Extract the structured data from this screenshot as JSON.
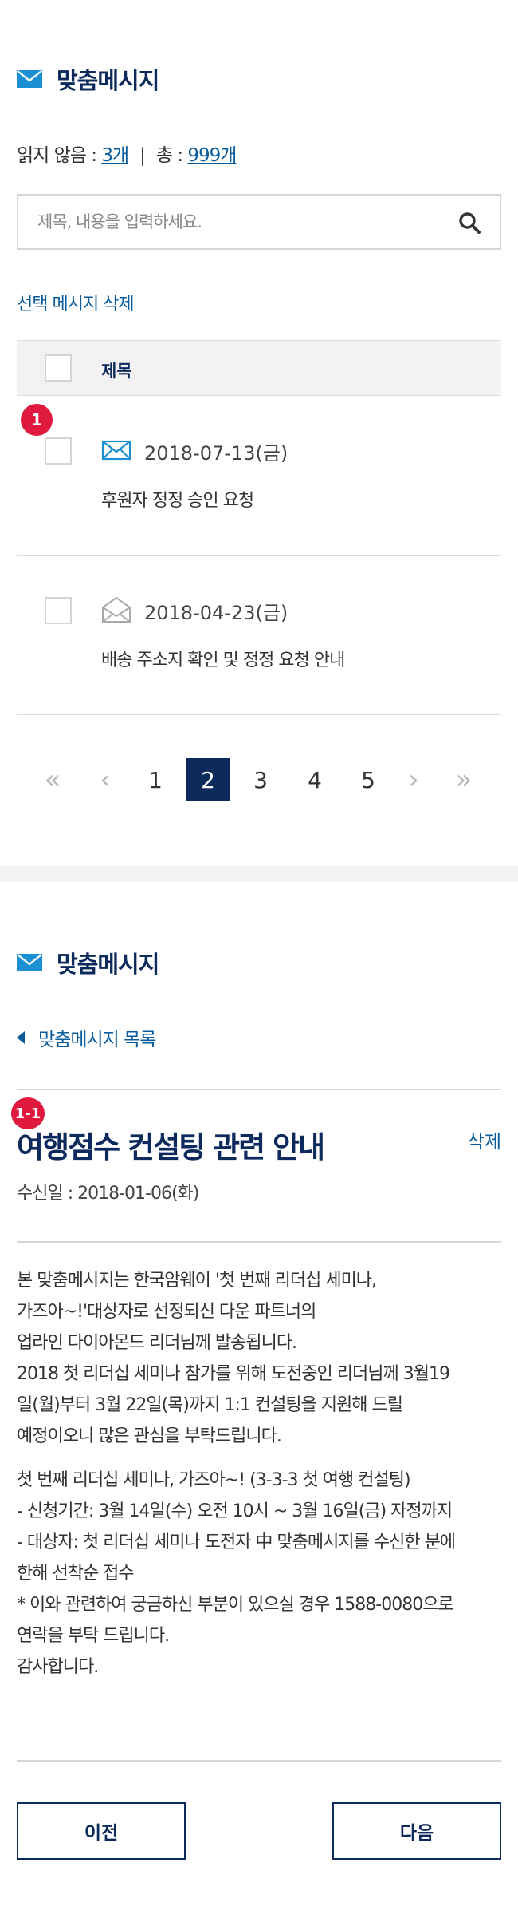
{
  "list": {
    "title": "맞춤메시지",
    "counts": {
      "unread_label": "읽지 않음 : ",
      "unread_value": "3개",
      "separator": "|",
      "total_label": "총 : ",
      "total_value": "999개"
    },
    "search": {
      "placeholder": "제목, 내용을 입력하세요."
    },
    "delete_selected_label": "선택 메시지 삭제",
    "table_header": "제목",
    "rows": [
      {
        "badge": "1",
        "date": "2018-07-13(금)",
        "subject": "후원자 정정 승인 요청",
        "status_icon": "envelope-unread-icon"
      },
      {
        "date": "2018-04-23(금)",
        "subject": "배송 주소지 확인 및 정정 요청 안내",
        "status_icon": "envelope-read-icon"
      }
    ],
    "pagination": {
      "first": "«",
      "prev": "‹",
      "pages": [
        "1",
        "2",
        "3",
        "4",
        "5"
      ],
      "current": "2",
      "next": "›",
      "last": "»"
    }
  },
  "detail": {
    "title": "맞춤메시지",
    "back_label": "맞춤메시지 목록",
    "badge": "1-1",
    "message_title": "여행점수 컨설팅 관련 안내",
    "delete_label": "삭제",
    "received_date": "수신일 : 2018-01-06(화)",
    "paragraph1": [
      "본 맞춤메시지는 한국암웨이 '첫 번째 리더십 세미나,",
      "가즈아~!'대상자로 선정되신 다운 파트너의",
      "업라인 다이아몬드 리더님께 발송됩니다.",
      "2018 첫 리더십 세미나 참가를 위해 도전중인 리더님께 3월19",
      "일(월)부터 3월 22일(목)까지 1:1 컨설팅을 지원해 드릴",
      "예정이오니 많은 관심을 부탁드립니다."
    ],
    "paragraph2": [
      "첫 번째 리더십 세미나, 가즈아~! (3-3-3 첫 여행 컨설팅)",
      "- 신청기간: 3월 14일(수) 오전 10시 ~ 3월 16일(금) 자정까지",
      "- 대상자: 첫 리더십 세미나 도전자 中 맞춤메시지를 수신한 분에",
      "한해 선착순 접수",
      "* 이와 관련하여 궁금하신 부분이 있으실 경우 1588-0080으로",
      "연락을 부탁 드립니다.",
      "감사합니다."
    ],
    "prev_button": "이전",
    "next_button": "다음"
  },
  "colors": {
    "navy": "#0c2a5b",
    "link_blue": "#0a5c9c",
    "badge_red": "#e0193f",
    "mail_icon": "#1a8fd1"
  }
}
